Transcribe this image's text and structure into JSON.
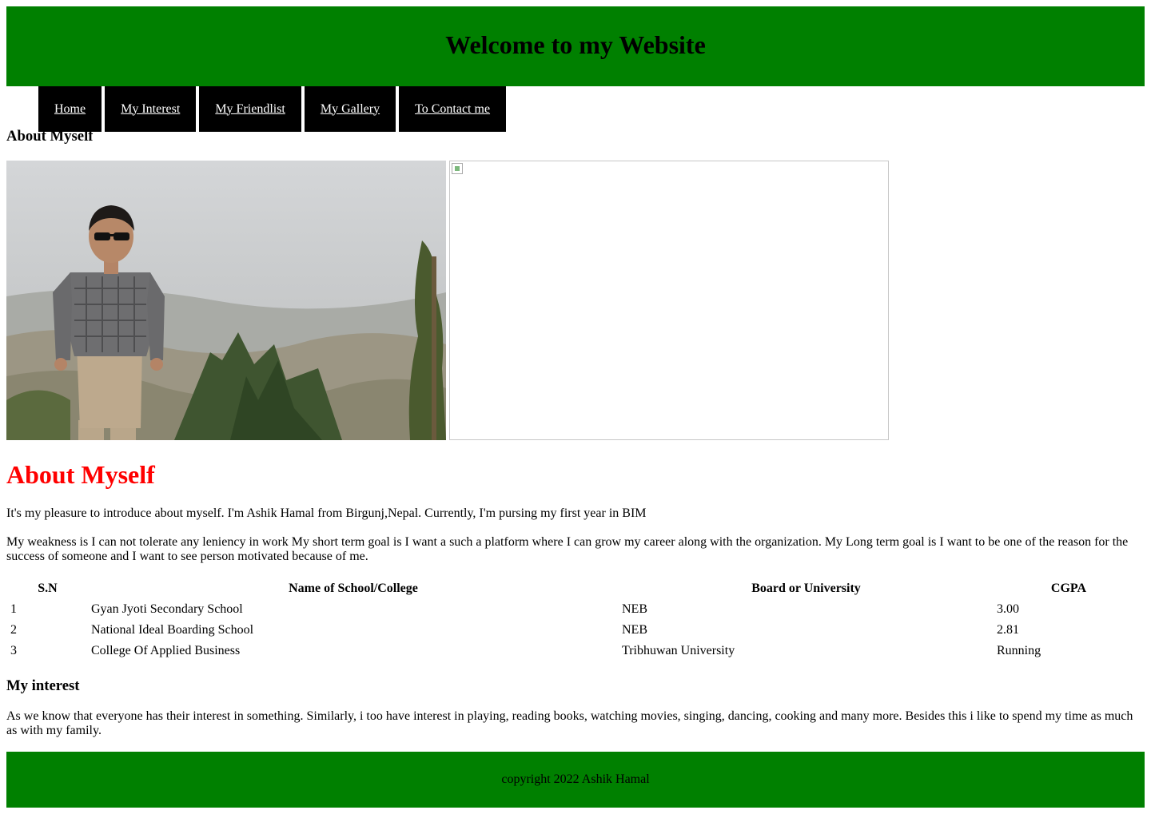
{
  "header": {
    "title": "Welcome to my Website"
  },
  "colors": {
    "header_bg": "#008000",
    "nav_bg": "#000000",
    "accent_heading": "#ff0000",
    "footer_bg": "#008000"
  },
  "nav": {
    "items": [
      {
        "label": "Home"
      },
      {
        "label": "My Interest"
      },
      {
        "label": "My Friendlist"
      },
      {
        "label": "My Gallery"
      },
      {
        "label": "To Contact me"
      }
    ]
  },
  "about": {
    "small_heading": "About Myself",
    "big_heading": "About Myself",
    "intro": "It's my pleasure to introduce about myself. I'm Ashik Hamal from Birgunj,Nepal. Currently, I'm pursing my first year in BIM",
    "goals": "My weakness is I can not tolerate any leniency in work My short term goal is I want a such a platform where I can grow my career along with the organization. My Long term goal is I want to be one of the reason for the success of someone and I want to see person motivated because of me."
  },
  "photos": [
    {
      "icon": "person-photo"
    },
    {
      "icon": "broken-image-icon"
    }
  ],
  "education": {
    "headers": [
      "S.N",
      "Name of School/College",
      "Board or University",
      "CGPA"
    ],
    "rows": [
      [
        "1",
        "Gyan Jyoti Secondary School",
        "NEB",
        "3.00"
      ],
      [
        "2",
        "National Ideal Boarding School",
        "NEB",
        "2.81"
      ],
      [
        "3",
        "College Of Applied Business",
        "Tribhuwan University",
        "Running"
      ]
    ]
  },
  "interest": {
    "heading": "My interest",
    "text": "As we know that everyone has their interest in something. Similarly, i too have interest in playing, reading books, watching movies, singing, dancing, cooking and many more. Besides this i like to spend my time as much as with my family."
  },
  "footer": {
    "text": "copyright 2022 Ashik Hamal"
  }
}
